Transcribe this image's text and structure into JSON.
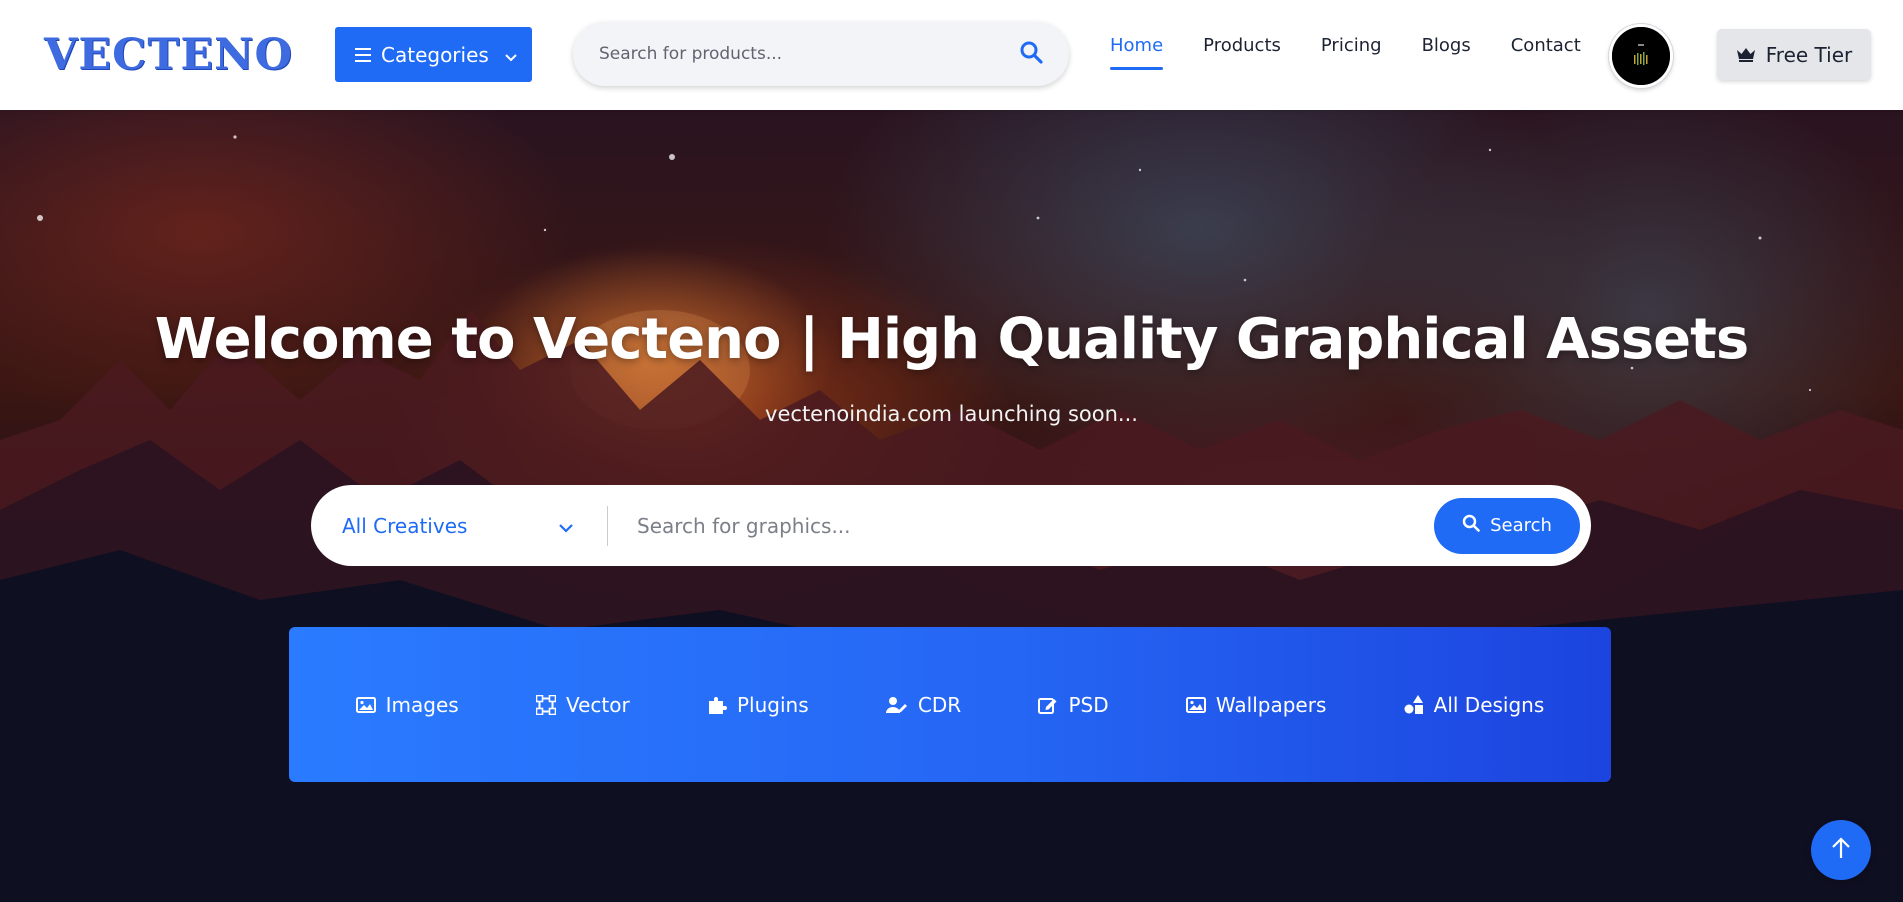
{
  "header": {
    "logo_text": "VECTENO",
    "categories_label": "Categories",
    "search_placeholder": "Search for products...",
    "nav": [
      {
        "label": "Home",
        "active": true
      },
      {
        "label": "Products",
        "active": false
      },
      {
        "label": "Pricing",
        "active": false
      },
      {
        "label": "Blogs",
        "active": false
      },
      {
        "label": "Contact",
        "active": false
      }
    ],
    "free_tier_label": "Free Tier"
  },
  "hero": {
    "title": "Welcome to Vecteno | High Quality Graphical Assets",
    "subtitle": "vectenoindia.com launching soon...",
    "select_value": "All Creatives",
    "search_placeholder": "Search for graphics...",
    "search_button": "Search"
  },
  "category_bar": {
    "items": [
      {
        "label": "Images",
        "icon": "image-icon"
      },
      {
        "label": "Vector",
        "icon": "vector-icon"
      },
      {
        "label": "Plugins",
        "icon": "puzzle-icon"
      },
      {
        "label": "CDR",
        "icon": "user-edit-icon"
      },
      {
        "label": "PSD",
        "icon": "edit-icon"
      },
      {
        "label": "Wallpapers",
        "icon": "image-icon"
      },
      {
        "label": "All Designs",
        "icon": "shapes-icon"
      }
    ]
  },
  "colors": {
    "primary": "#1f6bf5",
    "logo": "#3e6be0",
    "nav_text": "#1c2434"
  }
}
